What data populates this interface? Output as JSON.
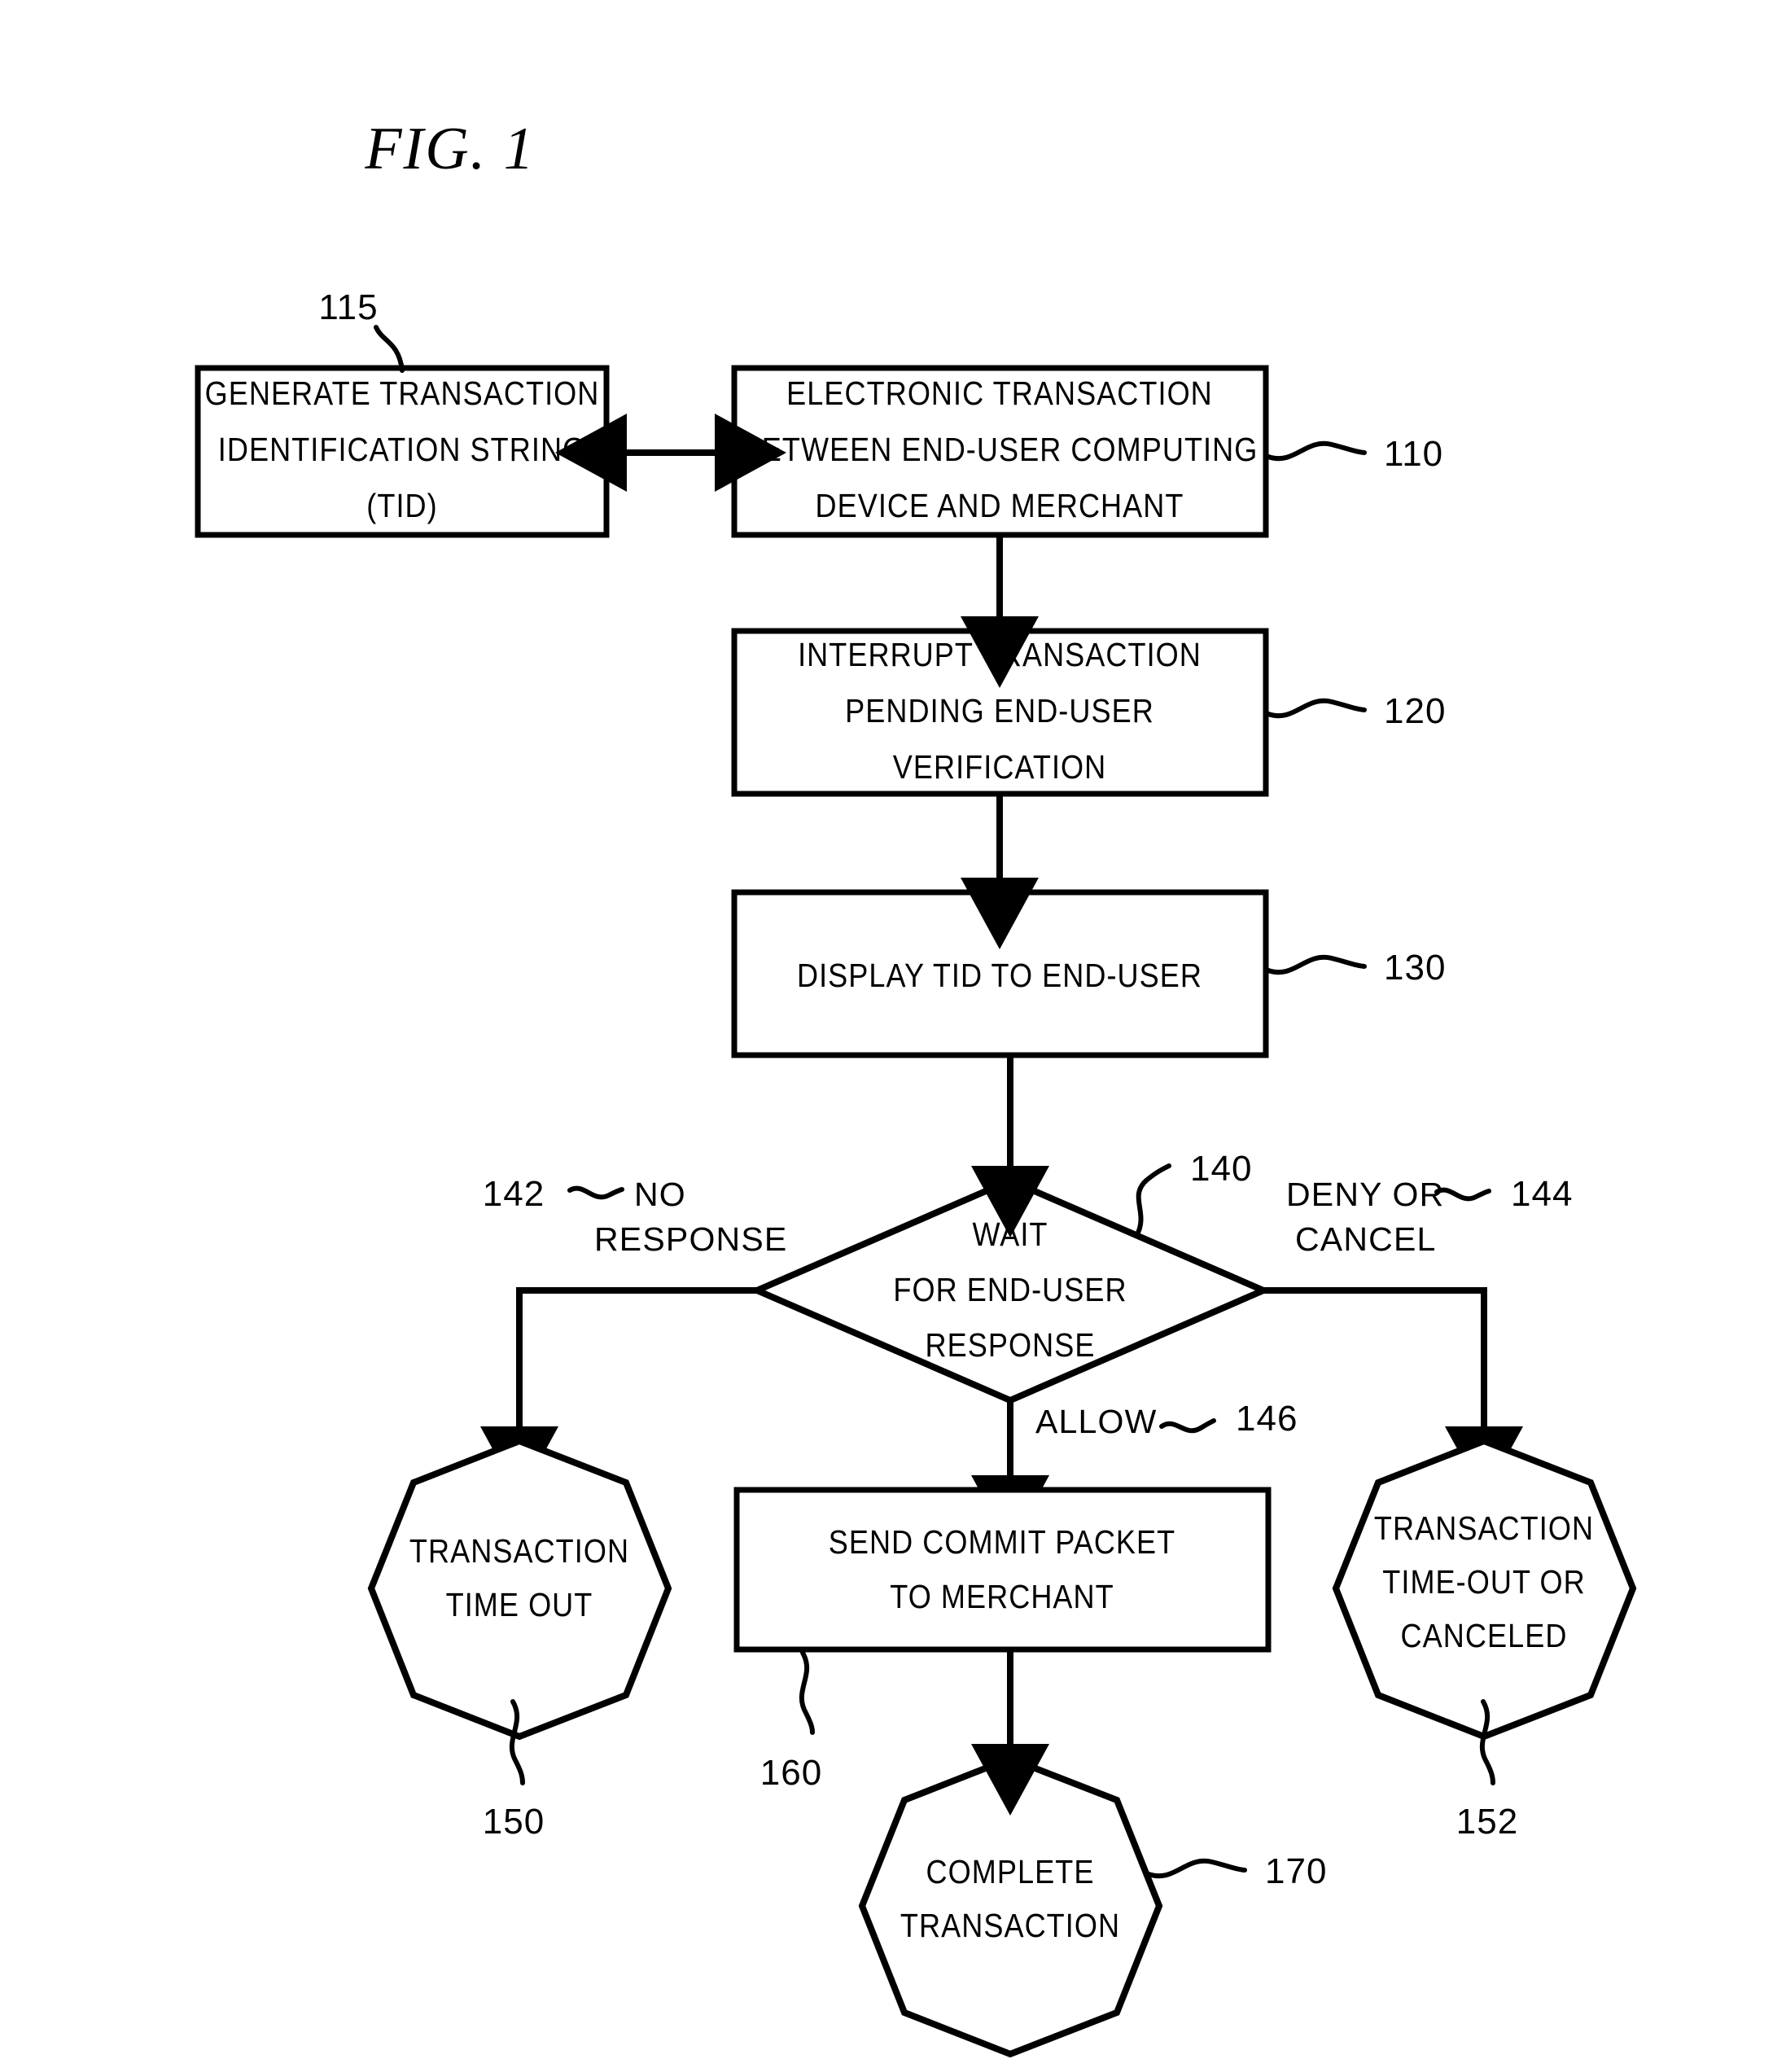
{
  "figure": {
    "title": "FIG. 1",
    "type": "patent-flowchart"
  },
  "nodes": {
    "n115": {
      "ref": "115",
      "shape": "rectangle",
      "lines": [
        "GENERATE TRANSACTION",
        "IDENTIFICATION STRING",
        "(TID)"
      ]
    },
    "n110": {
      "ref": "110",
      "shape": "rectangle",
      "lines": [
        "ELECTRONIC TRANSACTION",
        "BETWEEN END-USER COMPUTING",
        "DEVICE AND MERCHANT"
      ]
    },
    "n120": {
      "ref": "120",
      "shape": "rectangle",
      "lines": [
        "INTERRUPT TRANSACTION",
        "PENDING END-USER",
        "VERIFICATION"
      ]
    },
    "n130": {
      "ref": "130",
      "shape": "rectangle",
      "lines": [
        "DISPLAY TID TO END-USER"
      ]
    },
    "n140": {
      "ref": "140",
      "shape": "diamond",
      "lines": [
        "WAIT",
        "FOR END-USER",
        "RESPONSE"
      ]
    },
    "n150": {
      "ref": "150",
      "shape": "nonagon",
      "lines": [
        "TRANSACTION",
        "TIME OUT"
      ]
    },
    "n160": {
      "ref": "160",
      "shape": "rectangle",
      "lines": [
        "SEND COMMIT PACKET",
        "TO MERCHANT"
      ]
    },
    "n152": {
      "ref": "152",
      "shape": "nonagon",
      "lines": [
        "TRANSACTION",
        "TIME-OUT OR",
        "CANCELED"
      ]
    },
    "n170": {
      "ref": "170",
      "shape": "nonagon",
      "lines": [
        "COMPLETE",
        "TRANSACTION"
      ]
    }
  },
  "branches": {
    "b142": {
      "ref": "142",
      "lines": [
        "NO",
        "RESPONSE"
      ]
    },
    "b144": {
      "ref": "144",
      "lines": [
        "DENY OR",
        "CANCEL"
      ]
    },
    "b146": {
      "ref": "146",
      "lines": [
        "ALLOW"
      ]
    }
  },
  "colors": {
    "ink": "#000000",
    "paper": "#ffffff"
  }
}
